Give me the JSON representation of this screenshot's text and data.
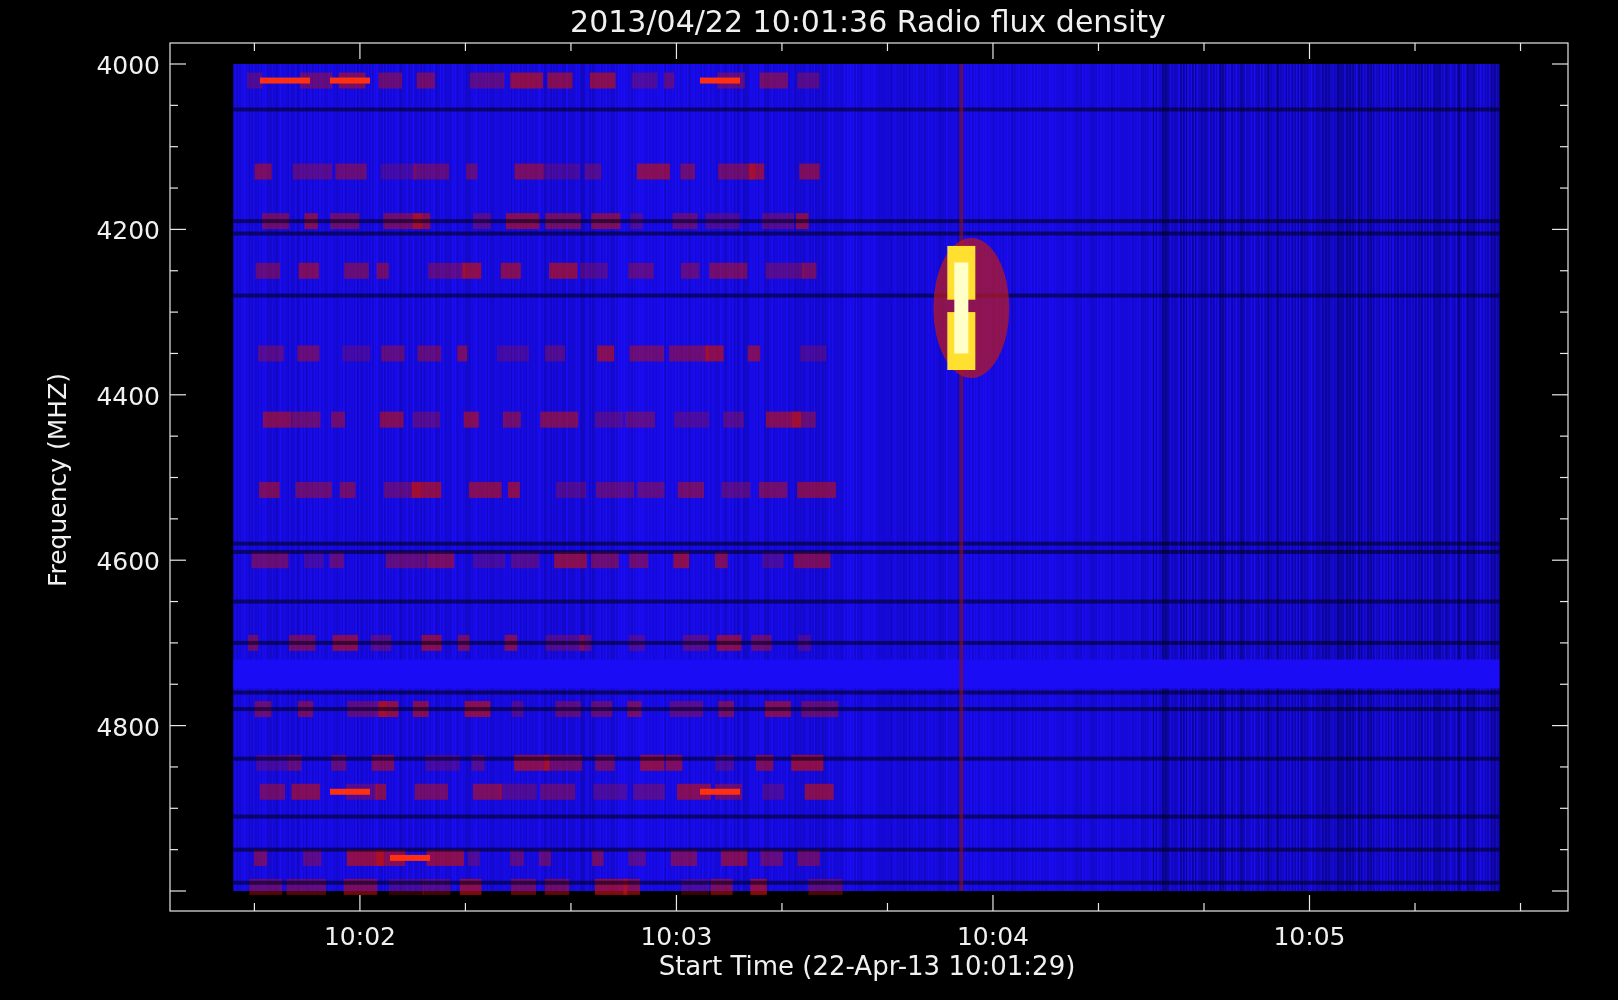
{
  "title": "2013/04/22 10:01:36 Radio flux density",
  "xlabel": "Start Time (22-Apr-13 10:01:29)",
  "ylabel": "Frequency (MHZ)",
  "xticks": [
    {
      "label": "10:02"
    },
    {
      "label": "10:03"
    },
    {
      "label": "10:04"
    },
    {
      "label": "10:05"
    }
  ],
  "yticks": [
    {
      "label": "4000"
    },
    {
      "label": "4200"
    },
    {
      "label": "4400"
    },
    {
      "label": "4600"
    },
    {
      "label": "4800"
    }
  ]
}
